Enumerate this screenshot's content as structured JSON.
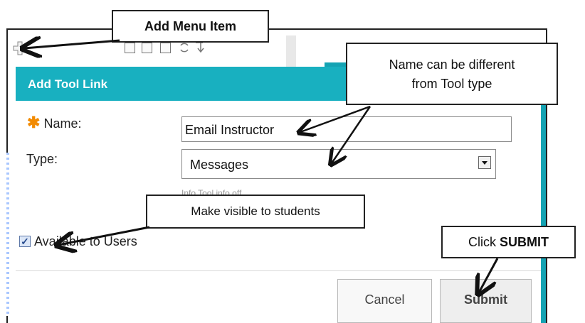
{
  "callouts": {
    "add_menu_item": "Add Menu Item",
    "name_diff_line1": "Name can be different",
    "name_diff_line2": "from Tool type",
    "make_visible": "Make visible to students",
    "click_prefix": "Click ",
    "click_emph": "SUBMIT"
  },
  "toolbar": {
    "icons": [
      "add-icon",
      "list-icon",
      "folder-icon",
      "copy-icon",
      "refresh-icon",
      "sort-icon"
    ]
  },
  "dialog": {
    "title": "Add Tool Link",
    "name_label": "Name:",
    "name_value": "Email Instructor",
    "type_label": "Type:",
    "type_value": "Messages",
    "hint_text": "Info  Tool info  off",
    "available_label": "Available to Users",
    "available_checked": true,
    "cancel_label": "Cancel",
    "submit_label": "Submit"
  },
  "colors": {
    "header": "#18b0c0",
    "stripe": "#14a3b3",
    "required": "#f28a00"
  }
}
